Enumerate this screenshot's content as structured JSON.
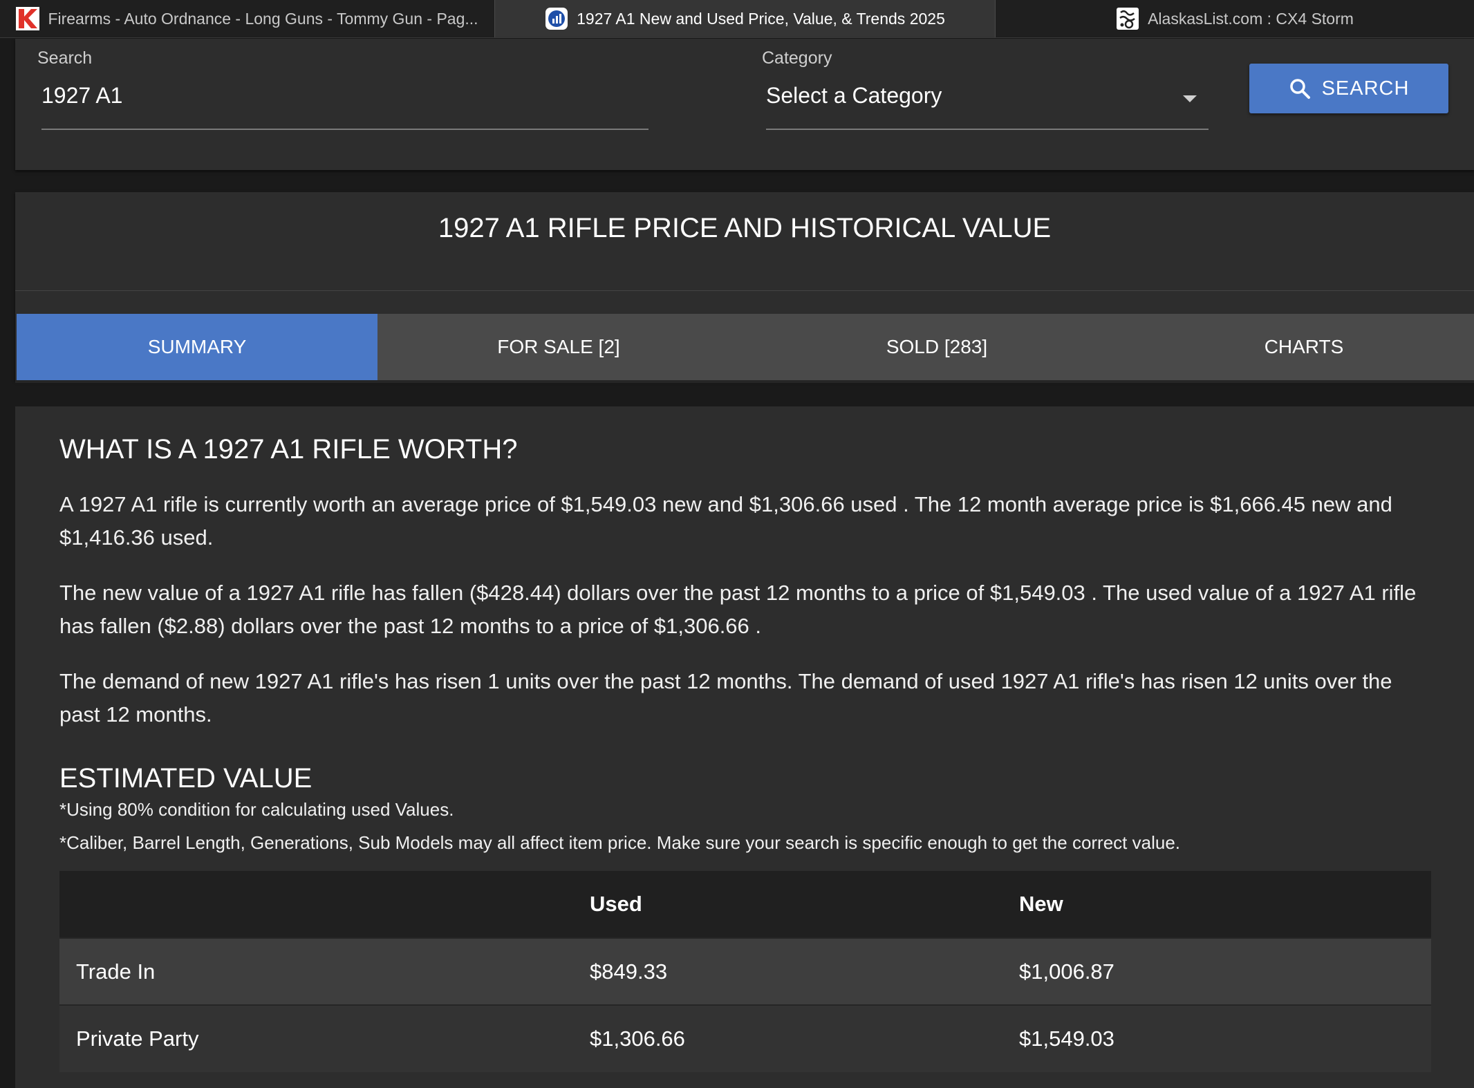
{
  "browser": {
    "tabs": [
      {
        "title": "Firearms - Auto Ordnance - Long Guns - Tommy Gun - Pag...",
        "active": false,
        "icon": "k-logo-icon"
      },
      {
        "title": "1927 A1 New and Used Price, Value, & Trends 2025",
        "active": true,
        "icon": "bar-chart-icon"
      },
      {
        "title": "AlaskasList.com : CX4 Storm",
        "active": false,
        "icon": "alaskaslist-icon"
      }
    ]
  },
  "search": {
    "label": "Search",
    "value": "1927 A1",
    "category_label": "Category",
    "category_value": "Select a Category",
    "button_label": "SEARCH"
  },
  "page": {
    "title": "1927 A1 RIFLE PRICE AND HISTORICAL VALUE",
    "tabs": [
      "SUMMARY",
      "FOR SALE [2]",
      "SOLD [283]",
      "CHARTS"
    ],
    "active_tab": 0
  },
  "summary": {
    "heading": "WHAT IS A 1927 A1 RIFLE WORTH?",
    "paragraphs": [
      "A 1927 A1 rifle is currently worth an average price of $1,549.03 new and $1,306.66 used . The 12 month average price is $1,666.45 new and $1,416.36 used.",
      "The new value of a 1927 A1 rifle has fallen ($428.44) dollars over the past 12 months to a price of $1,549.03 . The used value of a 1927 A1 rifle has fallen ($2.88) dollars over the past 12 months to a price of $1,306.66 .",
      "The demand of new 1927 A1 rifle's has risen 1 units over the past 12 months. The demand of used 1927 A1 rifle's has risen 12 units over the past 12 months."
    ],
    "estimated_heading": "ESTIMATED VALUE",
    "notes": [
      "*Using 80% condition for calculating used Values.",
      "*Caliber, Barrel Length, Generations, Sub Models may all affect item price. Make sure your search is specific enough to get the correct value."
    ],
    "table": {
      "headers": [
        "",
        "Used",
        "New"
      ],
      "rows": [
        [
          "Trade In",
          "$849.33",
          "$1,006.87"
        ],
        [
          "Private Party",
          "$1,306.66",
          "$1,549.03"
        ]
      ]
    }
  },
  "colors": {
    "accent": "#4a78c6",
    "background": "#1a1a1a",
    "card": "#2d2d2d"
  }
}
